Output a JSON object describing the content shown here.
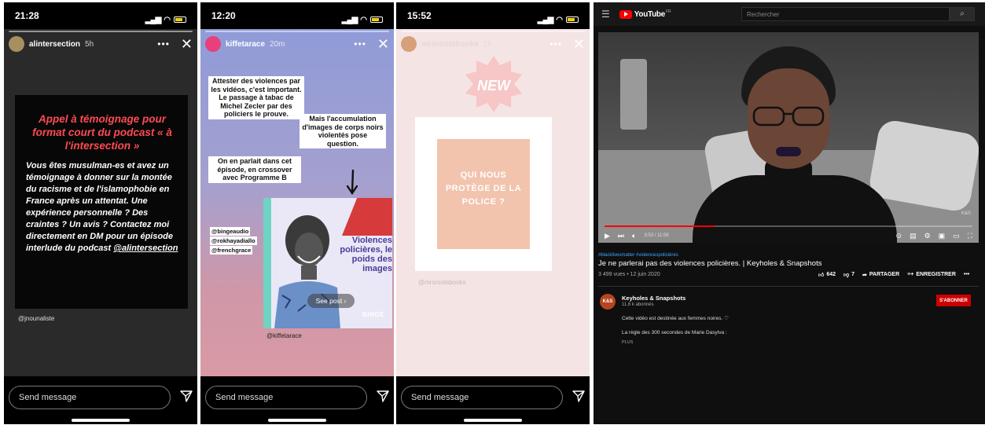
{
  "phones": [
    {
      "time": "21:28",
      "user": "alintersection",
      "posted": "5h",
      "heading": "Appel à témoignage pour format court du podcast « à l'intersection »",
      "body": "Vous êtes musulman-es et avez un témoignage à donner sur la montée du racisme et de l'islamophobie en France après un attentat. Une expérience personnelle ? Des craintes ? Un avis ? Contactez moi directement en DM pour un épisode interlude du podcast",
      "handle": "@alintersection",
      "credit": "@jnounaliste",
      "message_placeholder": "Send message"
    },
    {
      "time": "12:20",
      "user": "kiffetarace",
      "posted": "20m",
      "caption1": "Attester des violences par les vidéos, c'est important. Le passage à tabac de Michel Zecler par des policiers le prouve.",
      "caption2": "Mais l'accumulation d'images de corps noirs violentés pose question.",
      "caption3": "On en parlait dans cet épisode, en crossover avec Programme B",
      "tags": [
        "@bingeaudio",
        "@rokhayadiallo",
        "@frenchgrace"
      ],
      "poster_title": "Violences policières, le poids des images",
      "see_post": "See post ›",
      "poster_brand": "BINGE",
      "credit": "@kiffetarace",
      "message_placeholder": "Send message"
    },
    {
      "time": "15:52",
      "user": "mrsrootsbooks",
      "posted": "2h",
      "badge": "NEW",
      "inner_text": "QUI NOUS PROTÈGE DE LA POLICE ?",
      "credit": "@mrsrootsbooks",
      "message_placeholder": "Send message"
    }
  ],
  "youtube": {
    "brand": "YouTube",
    "region": "FR",
    "search_placeholder": "Rechercher",
    "progress_fraction": 0.3,
    "time_display": "3:53 / 11:56",
    "watermark": "K&S",
    "hashtags": "#blacklivesmatter #violencespolicières",
    "title": "Je ne parlerai pas des violences policières. | Keyholes & Snapshots",
    "meta": "3 499 vues • 12 juin 2020",
    "likes": "642",
    "dislikes": "7",
    "share_label": "PARTAGER",
    "save_label": "ENREGISTRER",
    "channel_avatar_text": "K&S",
    "channel_name": "Keyholes & Snapshots",
    "subscribers": "11,6 k abonnés",
    "subscribe_label": "S'ABONNER",
    "desc1": "Cette vidéo est destinée aux femmes noires. ♡",
    "desc2": "La règle des 300 secondes de Marie Dasylva :",
    "more_label": "PLUS"
  },
  "colors": {
    "red_heading": "#ff4a52",
    "yt_red": "#ff0000",
    "link_blue": "#3ea6ff"
  }
}
